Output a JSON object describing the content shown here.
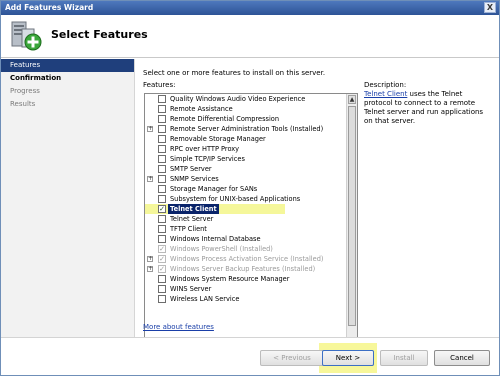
{
  "window": {
    "title": "Add Features Wizard",
    "close_glyph": "X"
  },
  "header": {
    "title": "Select Features",
    "icon": "features-wizard-icon"
  },
  "sidebar": {
    "items": [
      {
        "label": "Features",
        "state": "active"
      },
      {
        "label": "Confirmation",
        "state": "current"
      },
      {
        "label": "Progress",
        "state": "disabled"
      },
      {
        "label": "Results",
        "state": "disabled"
      }
    ]
  },
  "main": {
    "intro": "Select one or more features to install on this server.",
    "features_label": "Features:",
    "description_label": "Description:",
    "description_link": "Telnet Client",
    "description_rest": " uses the Telnet protocol to connect to a remote Telnet server and run applications on that server.",
    "more_link": "More about features"
  },
  "features": [
    {
      "label": "Quality Windows Audio Video Experience",
      "expander": false,
      "checked": false,
      "disabled": false
    },
    {
      "label": "Remote Assistance",
      "expander": false,
      "checked": false,
      "disabled": false
    },
    {
      "label": "Remote Differential Compression",
      "expander": false,
      "checked": false,
      "disabled": false
    },
    {
      "label": "Remote Server Administration Tools  (Installed)",
      "expander": true,
      "checked": false,
      "disabled": false
    },
    {
      "label": "Removable Storage Manager",
      "expander": false,
      "checked": false,
      "disabled": false
    },
    {
      "label": "RPC over HTTP Proxy",
      "expander": false,
      "checked": false,
      "disabled": false
    },
    {
      "label": "Simple TCP/IP Services",
      "expander": false,
      "checked": false,
      "disabled": false
    },
    {
      "label": "SMTP Server",
      "expander": false,
      "checked": false,
      "disabled": false
    },
    {
      "label": "SNMP Services",
      "expander": true,
      "checked": false,
      "disabled": false
    },
    {
      "label": "Storage Manager for SANs",
      "expander": false,
      "checked": false,
      "disabled": false
    },
    {
      "label": "Subsystem for UNIX-based Applications",
      "expander": false,
      "checked": false,
      "disabled": false
    },
    {
      "label": "Telnet Client",
      "expander": false,
      "checked": true,
      "disabled": false,
      "selected": true
    },
    {
      "label": "Telnet Server",
      "expander": false,
      "checked": false,
      "disabled": false
    },
    {
      "label": "TFTP Client",
      "expander": false,
      "checked": false,
      "disabled": false
    },
    {
      "label": "Windows Internal Database",
      "expander": false,
      "checked": false,
      "disabled": false
    },
    {
      "label": "Windows PowerShell  (Installed)",
      "expander": false,
      "checked": true,
      "disabled": true
    },
    {
      "label": "Windows Process Activation Service  (Installed)",
      "expander": true,
      "checked": true,
      "disabled": true
    },
    {
      "label": "Windows Server Backup Features  (Installed)",
      "expander": true,
      "checked": true,
      "disabled": true
    },
    {
      "label": "Windows System Resource Manager",
      "expander": false,
      "checked": false,
      "disabled": false
    },
    {
      "label": "WINS Server",
      "expander": false,
      "checked": false,
      "disabled": false
    },
    {
      "label": "Wireless LAN Service",
      "expander": false,
      "checked": false,
      "disabled": false
    }
  ],
  "buttons": {
    "previous": "< Previous",
    "next": "Next >",
    "install": "Install",
    "cancel": "Cancel"
  },
  "colors": {
    "selection": "#0a246a",
    "highlight": "#f5f79a",
    "link": "#1a3fa8",
    "titlebar": "#3d64a8"
  }
}
